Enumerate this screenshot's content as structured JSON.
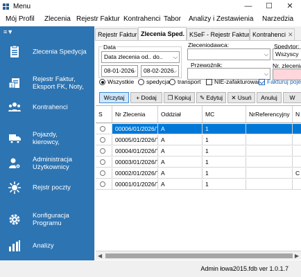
{
  "window": {
    "title": "Menu",
    "minimize": "—",
    "maximize": "☐",
    "close": "✕"
  },
  "menu": [
    "Mój Profil",
    "Zlecenia",
    "Rejestr Faktur",
    "Kontrahenci",
    "Tabor",
    "Analizy i Zestawienia",
    "Narzedzia"
  ],
  "sidebar": {
    "toggle": "≡▼",
    "items": [
      {
        "label": "Zlecenia Spedycja",
        "icon": "document-list-icon"
      },
      {
        "label": "Rejestr Faktur,\nEksport FK, Noty,",
        "icon": "invoice-icon"
      },
      {
        "label": "Kontrahenci",
        "icon": "people-icon"
      },
      {
        "label": "Pojazdy,\nkierowcy,",
        "icon": "truck-icon"
      },
      {
        "label": "Administracja\nUżytkownicy",
        "icon": "admin-users-icon"
      },
      {
        "label": "Rejstr poczty",
        "icon": "mail-registry-icon"
      },
      {
        "label": "Konfiguracja\nProgramu",
        "icon": "settings-icon"
      },
      {
        "label": "Analizy",
        "icon": "chart-icon"
      }
    ]
  },
  "tabs": [
    {
      "label": "Rejestr Faktur",
      "active": false
    },
    {
      "label": "Zlecenia Sped.",
      "active": true
    },
    {
      "label": "KSeF - Rejestr Faktur",
      "active": false
    },
    {
      "label": "Kontrahenci",
      "active": false
    }
  ],
  "tab_close": "✕",
  "filters": {
    "data_label": "Data",
    "date_type": "Data zlecenia od.. do..",
    "date_from": "08-01-2026",
    "date_to": "08-02-2026",
    "zleceniodawca_label": "Zleceniodawca:",
    "zleceniodawca_value": "",
    "spedytor_label": "Spedytor:",
    "spedytor_value": "Wszyscy",
    "przewoznik_label": "Przewoźnik:",
    "przewoznik_value": "",
    "nr_zlecenia_label": "Nr. zlecenia",
    "radio_all": "Wszystkie",
    "radio_spedycja": "spedycja",
    "radio_transport": "transport",
    "nie_zafakturowane": "NIE-zafakturowane",
    "fakturuj": "Fakturuj poje"
  },
  "toolbar": {
    "wczytaj": "Wczytaj",
    "dodaj": "+ Dodaj",
    "kopiuj": "❐ Kopiuj",
    "edytuj": "✎ Edytuj",
    "usun": "✕ Usuń",
    "anuluj": "Anuluj",
    "more": "W"
  },
  "grid": {
    "columns": [
      "S",
      "Nr Zlecenia",
      "Oddział",
      "MC",
      "NrReferencyjny",
      "N"
    ],
    "rows": [
      {
        "nr": "00006/01/2026/T",
        "oddzial": "A",
        "mc": "1",
        "ref": "",
        "n": "",
        "selected": true
      },
      {
        "nr": "00005/01/2026/T",
        "oddzial": "A",
        "mc": "1",
        "ref": "",
        "n": ""
      },
      {
        "nr": "00004/01/2026/T",
        "oddzial": "A",
        "mc": "1",
        "ref": "",
        "n": ""
      },
      {
        "nr": "00003/01/2026/T",
        "oddzial": "A",
        "mc": "1",
        "ref": "",
        "n": ""
      },
      {
        "nr": "00002/01/2026/T",
        "oddzial": "A",
        "mc": "1",
        "ref": "",
        "n": "C"
      },
      {
        "nr": "00001/01/2026/T",
        "oddzial": "A",
        "mc": "1",
        "ref": "",
        "n": ""
      }
    ]
  },
  "status": "Admin  łowa2015.fdb  ver 1.0.1.7",
  "colors": {
    "sidebar": "#2d74b2",
    "selection": "#0078d7",
    "accent_button": "#cfe6fa",
    "nr_field": "#ffd6dc"
  }
}
